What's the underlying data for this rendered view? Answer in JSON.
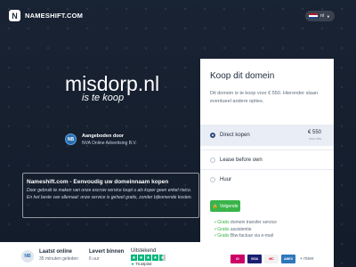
{
  "header": {
    "logo_mark": "N",
    "logo_text": "NAMESHIFT.COM",
    "language": "nl"
  },
  "hero": {
    "domain": "misdorp.nl",
    "tagline": "is te koop"
  },
  "seller": {
    "badge": "NB",
    "label": "Aangeboden door",
    "name": "NVA Online Advertising B.V."
  },
  "info": {
    "title": "Nameshift.com - Eenvoudig uw domeinnaam kopen",
    "text": "Door gebruik te maken van onze escrow service loopt u als koper geen enkel risico. En het beste van allemaal: onze service is geheel gratis, zonder bijkomende kosten."
  },
  "bottom_bar": {
    "badge": "NB",
    "online_label": "Laatst online",
    "online_value": "35 minuten geleden",
    "delivery_label": "Levert binnen",
    "delivery_value": "6 uur",
    "rating_label": "Uitstekend",
    "rating_stars": 4.5,
    "trustpilot": "Trustpilot"
  },
  "panel": {
    "title": "Koop dit domein",
    "description": "Dit domein is te koop voor € 550. Hieronder staan eventueel andere opties.",
    "options": [
      {
        "label": "Direct kopen",
        "price": "€ 550",
        "price_note": "excl. btw",
        "selected": true
      },
      {
        "label": "Lease before own",
        "selected": false
      },
      {
        "label": "Huur",
        "selected": false
      }
    ],
    "button_label": "Volgende",
    "features": [
      {
        "check": "✓",
        "prefix": "Gratis",
        "text": " domein transfer service"
      },
      {
        "check": "✓",
        "prefix": "Gratis",
        "text": " assistentie"
      },
      {
        "check": "✓",
        "prefix": "Gratis",
        "text": " Btw-factuur via e-mail"
      }
    ],
    "payments": [
      "iD",
      "VISA",
      "MC",
      "AMEX"
    ],
    "payments_more": "+ meer"
  },
  "colors": {
    "accent_green": "#38b449",
    "dark_navy": "#1f2b3b",
    "flag_red": "#ae1c28",
    "flag_white": "#ffffff",
    "flag_blue": "#21468b"
  }
}
